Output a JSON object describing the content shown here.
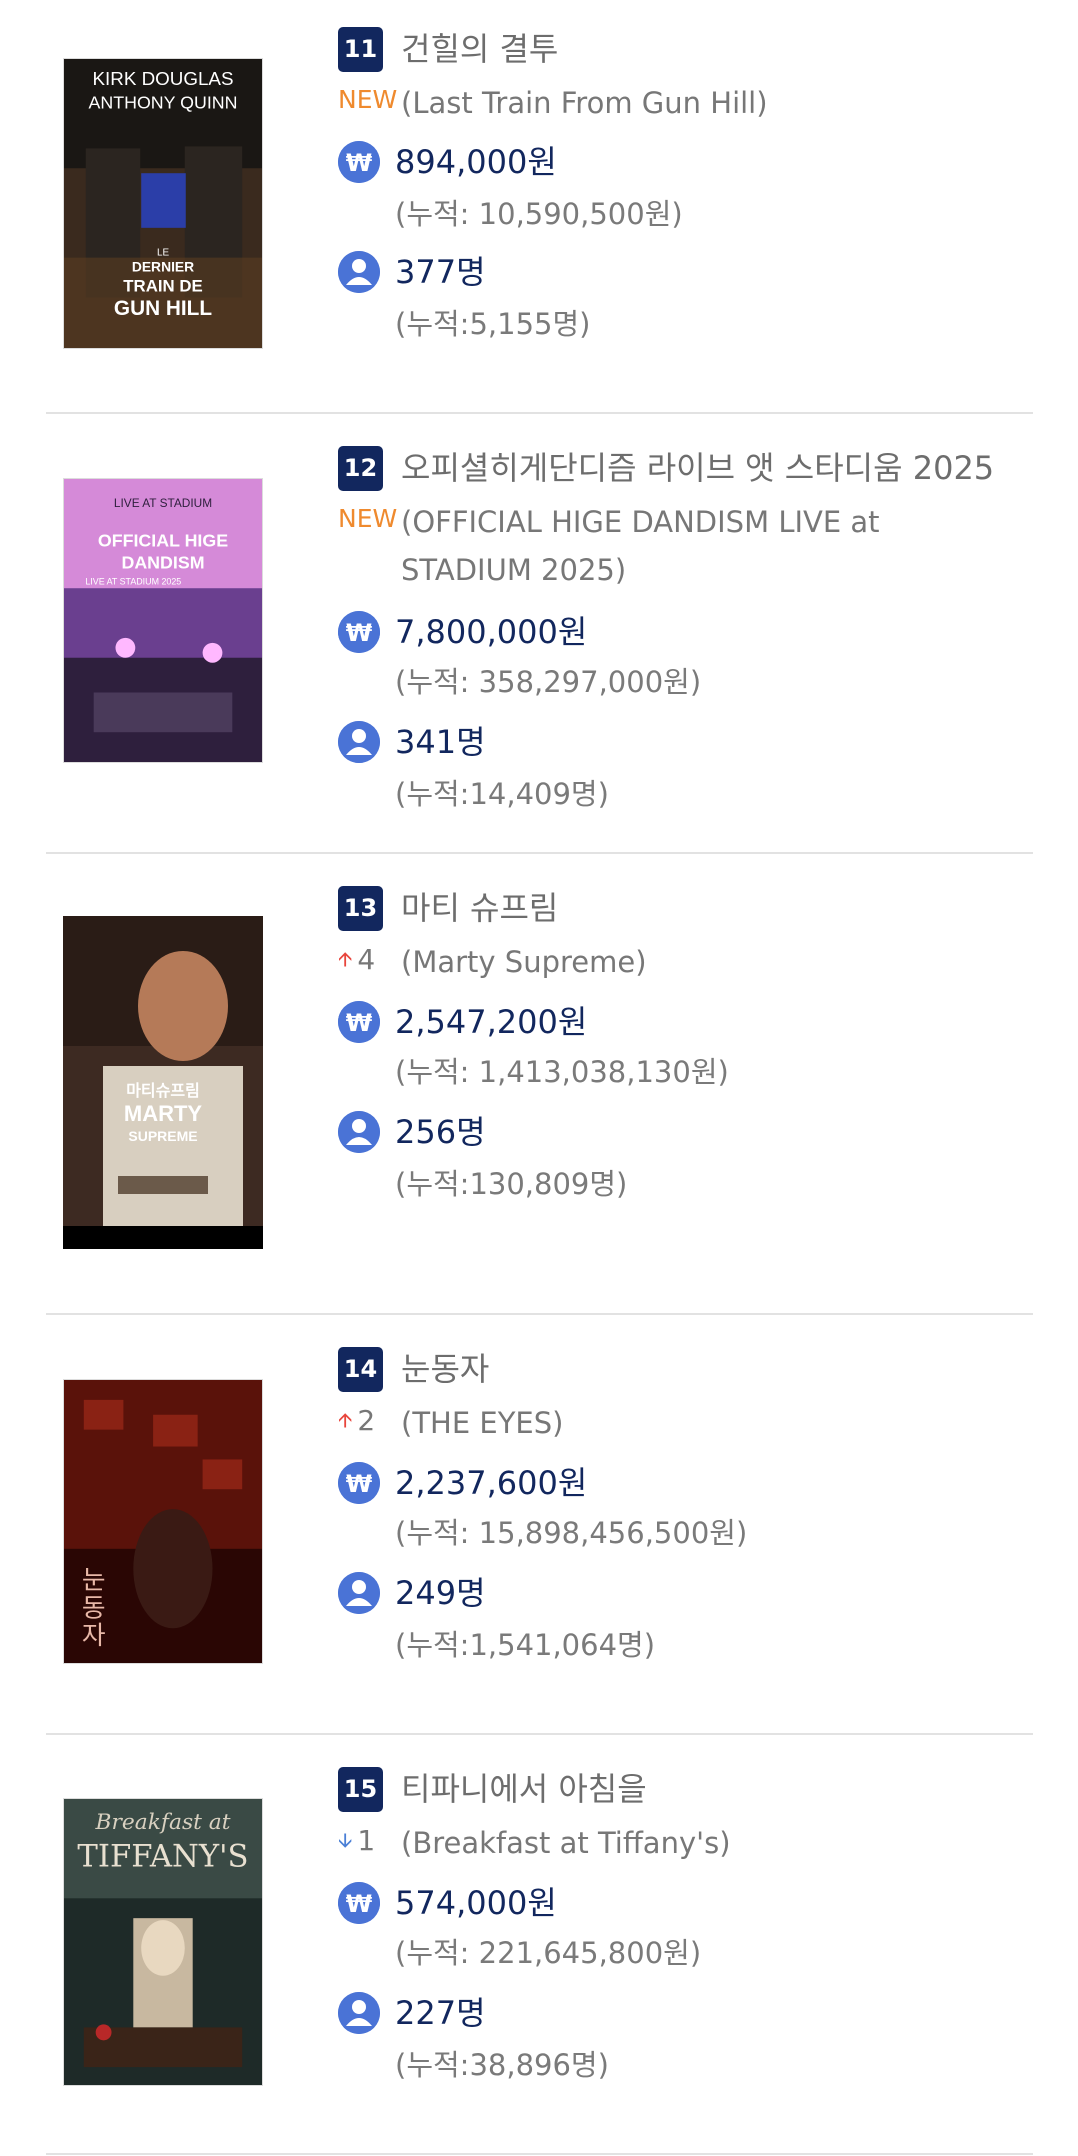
{
  "items": [
    {
      "rank": "11",
      "title_ko": "건힐의 결투",
      "change_type": "new",
      "change_label": "NEW",
      "title_en": "(Last Train From Gun Hill)",
      "sales": "894,000원",
      "sales_total": "(누적: 10,590,500원)",
      "audience": "377명",
      "audience_total": "(누적:5,155명)",
      "poster_text": [
        "KIRK DOUGLAS",
        "ANTHONY QUINN",
        "LE",
        "DERNIER",
        "TRAIN DE",
        "GUN HILL"
      ]
    },
    {
      "rank": "12",
      "title_ko": "오피셜히게단디즘 라이브 앳 스타디움 2025",
      "change_type": "new",
      "change_label": "NEW",
      "title_en": "(OFFICIAL HIGE DANDISM LIVE at STADIUM 2025)",
      "sales": "7,800,000원",
      "sales_total": "(누적: 358,297,000원)",
      "audience": "341명",
      "audience_total": "(누적:14,409명)",
      "poster_text": [
        "LIVE AT STADIUM",
        "OFFICIAL HIGE",
        "DANDISM",
        "LIVE AT STADIUM 2025"
      ]
    },
    {
      "rank": "13",
      "title_ko": "마티 슈프림",
      "change_type": "up",
      "change_label": "4",
      "title_en": "(Marty Supreme)",
      "sales": "2,547,200원",
      "sales_total": "(누적: 1,413,038,130원)",
      "audience": "256명",
      "audience_total": "(누적:130,809명)",
      "poster_text": [
        "마티슈프림",
        "MARTY",
        "SUPREME"
      ]
    },
    {
      "rank": "14",
      "title_ko": "눈동자",
      "change_type": "up",
      "change_label": "2",
      "title_en": "(THE EYES)",
      "sales": "2,237,600원",
      "sales_total": "(누적: 15,898,456,500원)",
      "audience": "249명",
      "audience_total": "(누적:1,541,064명)",
      "poster_text": [
        "눈",
        "동",
        "자"
      ]
    },
    {
      "rank": "15",
      "title_ko": "티파니에서 아침을",
      "change_type": "down",
      "change_label": "1",
      "title_en": "(Breakfast at Tiffany's)",
      "sales": "574,000원",
      "sales_total": "(누적: 221,645,800원)",
      "audience": "227명",
      "audience_total": "(누적:38,896명)",
      "poster_text": [
        "Breakfast at",
        "TIFFANY'S"
      ]
    }
  ],
  "icons": {
    "sales": "won-icon",
    "audience": "person-icon",
    "up": "arrow-up-icon",
    "down": "arrow-down-icon"
  },
  "colors": {
    "badge": "#12275e",
    "icon": "#4a73d6",
    "new": "#ef8a2e",
    "up": "#e8453c",
    "down": "#4a7fd6"
  }
}
